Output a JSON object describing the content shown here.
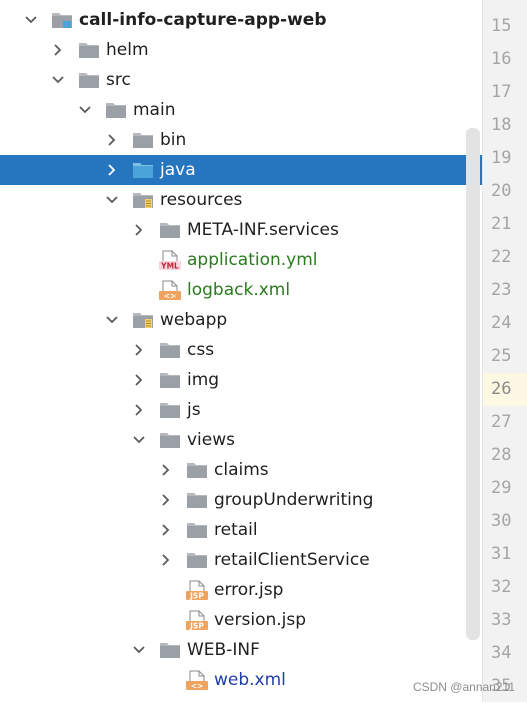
{
  "tree": {
    "rows": [
      {
        "label": "call-info-capture-app-web",
        "icon": "module-folder-icon",
        "arrow": "down",
        "depth": 0,
        "style": "bold"
      },
      {
        "label": "helm",
        "icon": "folder-icon",
        "arrow": "right",
        "depth": 1
      },
      {
        "label": "src",
        "icon": "folder-icon",
        "arrow": "down",
        "depth": 1
      },
      {
        "label": "main",
        "icon": "folder-icon",
        "arrow": "down",
        "depth": 2
      },
      {
        "label": "bin",
        "icon": "folder-icon",
        "arrow": "right",
        "depth": 3
      },
      {
        "label": "java",
        "icon": "source-folder-icon",
        "arrow": "right",
        "depth": 3,
        "selected": true
      },
      {
        "label": "resources",
        "icon": "resources-folder-icon",
        "arrow": "down",
        "depth": 3
      },
      {
        "label": "META-INF.services",
        "icon": "folder-icon",
        "arrow": "right",
        "depth": 4
      },
      {
        "label": "application.yml",
        "icon": "yml-file-icon",
        "arrow": "none",
        "depth": 4,
        "style": "green"
      },
      {
        "label": "logback.xml",
        "icon": "xml-file-icon",
        "arrow": "none",
        "depth": 4,
        "style": "green"
      },
      {
        "label": "webapp",
        "icon": "web-folder-icon",
        "arrow": "down",
        "depth": 3
      },
      {
        "label": "css",
        "icon": "folder-icon",
        "arrow": "right",
        "depth": 4
      },
      {
        "label": "img",
        "icon": "folder-icon",
        "arrow": "right",
        "depth": 4
      },
      {
        "label": "js",
        "icon": "folder-icon",
        "arrow": "right",
        "depth": 4
      },
      {
        "label": "views",
        "icon": "folder-icon",
        "arrow": "down",
        "depth": 4
      },
      {
        "label": "claims",
        "icon": "folder-icon",
        "arrow": "right",
        "depth": 5
      },
      {
        "label": "groupUnderwriting",
        "icon": "folder-icon",
        "arrow": "right",
        "depth": 5
      },
      {
        "label": "retail",
        "icon": "folder-icon",
        "arrow": "right",
        "depth": 5
      },
      {
        "label": "retailClientService",
        "icon": "folder-icon",
        "arrow": "right",
        "depth": 5
      },
      {
        "label": "error.jsp",
        "icon": "jsp-file-icon",
        "arrow": "none",
        "depth": 5
      },
      {
        "label": "version.jsp",
        "icon": "jsp-file-icon",
        "arrow": "none",
        "depth": 5
      },
      {
        "label": "WEB-INF",
        "icon": "folder-icon",
        "arrow": "down",
        "depth": 4
      },
      {
        "label": "web.xml",
        "icon": "xml-file-icon",
        "arrow": "none",
        "depth": 5,
        "style": "blue"
      }
    ]
  },
  "gutter": {
    "line_numbers": [
      "15",
      "16",
      "17",
      "18",
      "19",
      "20",
      "21",
      "22",
      "23",
      "24",
      "25",
      "26",
      "27",
      "28",
      "29",
      "30",
      "31",
      "32",
      "33",
      "34",
      "35"
    ],
    "current_line": "26"
  },
  "icon_badges": {
    "yml": "YML",
    "jsp": "JSP",
    "xml": "<>"
  },
  "watermark": "CSDN @annan211",
  "colors": {
    "selection": "#2675bf",
    "folder": "#9aa0a6",
    "source_folder": "#4aa3d9",
    "modified_file_text": "#2b7a1f",
    "web_xml_text": "#1f3dab",
    "gutter_bg": "#f2f2f2",
    "current_line_bg": "#fdf8e4"
  }
}
